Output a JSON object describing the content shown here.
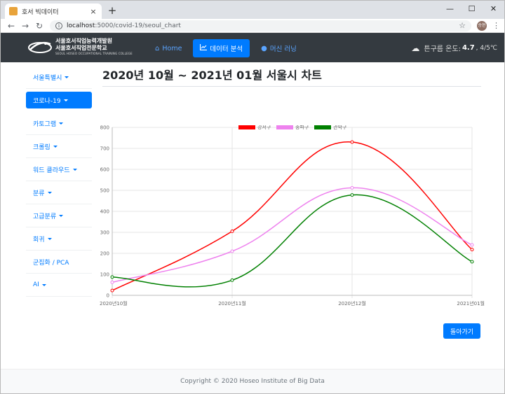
{
  "browser": {
    "tab_title": "호서 빅데이터",
    "url_host": "localhost",
    "url_rest": ":5000/covid-19/seoul_chart",
    "profile_initials": "승현"
  },
  "navbar": {
    "logo_line1": "서울호서직업능력개발원",
    "logo_line2": "서울호서직업전문학교",
    "logo_line3": "SEOUL HOSEO OCCUPATIONAL TRAINING COLLEGE",
    "links": [
      {
        "label": "Home",
        "icon": "home-icon"
      },
      {
        "label": "데이터 분석",
        "icon": "chart-line-icon"
      },
      {
        "label": "머신 러닝",
        "icon": "brain-icon"
      }
    ],
    "weather_prefix": "흐림",
    "weather_label": "튼구름 온도:",
    "weather_temp": "4.7",
    "weather_range": ", 4/5℃"
  },
  "sidebar": {
    "items": [
      {
        "label": "서울특별시"
      },
      {
        "label": "코로나-19"
      },
      {
        "label": "카토그램"
      },
      {
        "label": "크롤링"
      },
      {
        "label": "워드 클라우드"
      },
      {
        "label": "분류"
      },
      {
        "label": "고급분류"
      },
      {
        "label": "회귀"
      },
      {
        "label": "군집화 / PCA"
      },
      {
        "label": "AI"
      }
    ]
  },
  "main": {
    "title": "2020년 10월 ~ 2021년 01월 서울시 차트",
    "back_label": "돌아가기"
  },
  "chart_data": {
    "type": "line",
    "categories": [
      "2020년10월",
      "2020년11월",
      "2020년12월",
      "2021년01월"
    ],
    "series": [
      {
        "name": "강서구",
        "color": "#ff0000",
        "values": [
          23,
          305,
          730,
          218
        ]
      },
      {
        "name": "송파구",
        "color": "#ee82ee",
        "values": [
          62,
          210,
          512,
          240
        ]
      },
      {
        "name": "관악구",
        "color": "#008000",
        "values": [
          87,
          72,
          478,
          160
        ]
      }
    ],
    "ylim": [
      0,
      800
    ],
    "yticks": [
      0,
      100,
      200,
      300,
      400,
      500,
      600,
      700,
      800
    ],
    "grid": true,
    "legend": "top"
  },
  "footer": {
    "copyright": "Copyright © 2020 Hoseo Institute of Big Data"
  }
}
